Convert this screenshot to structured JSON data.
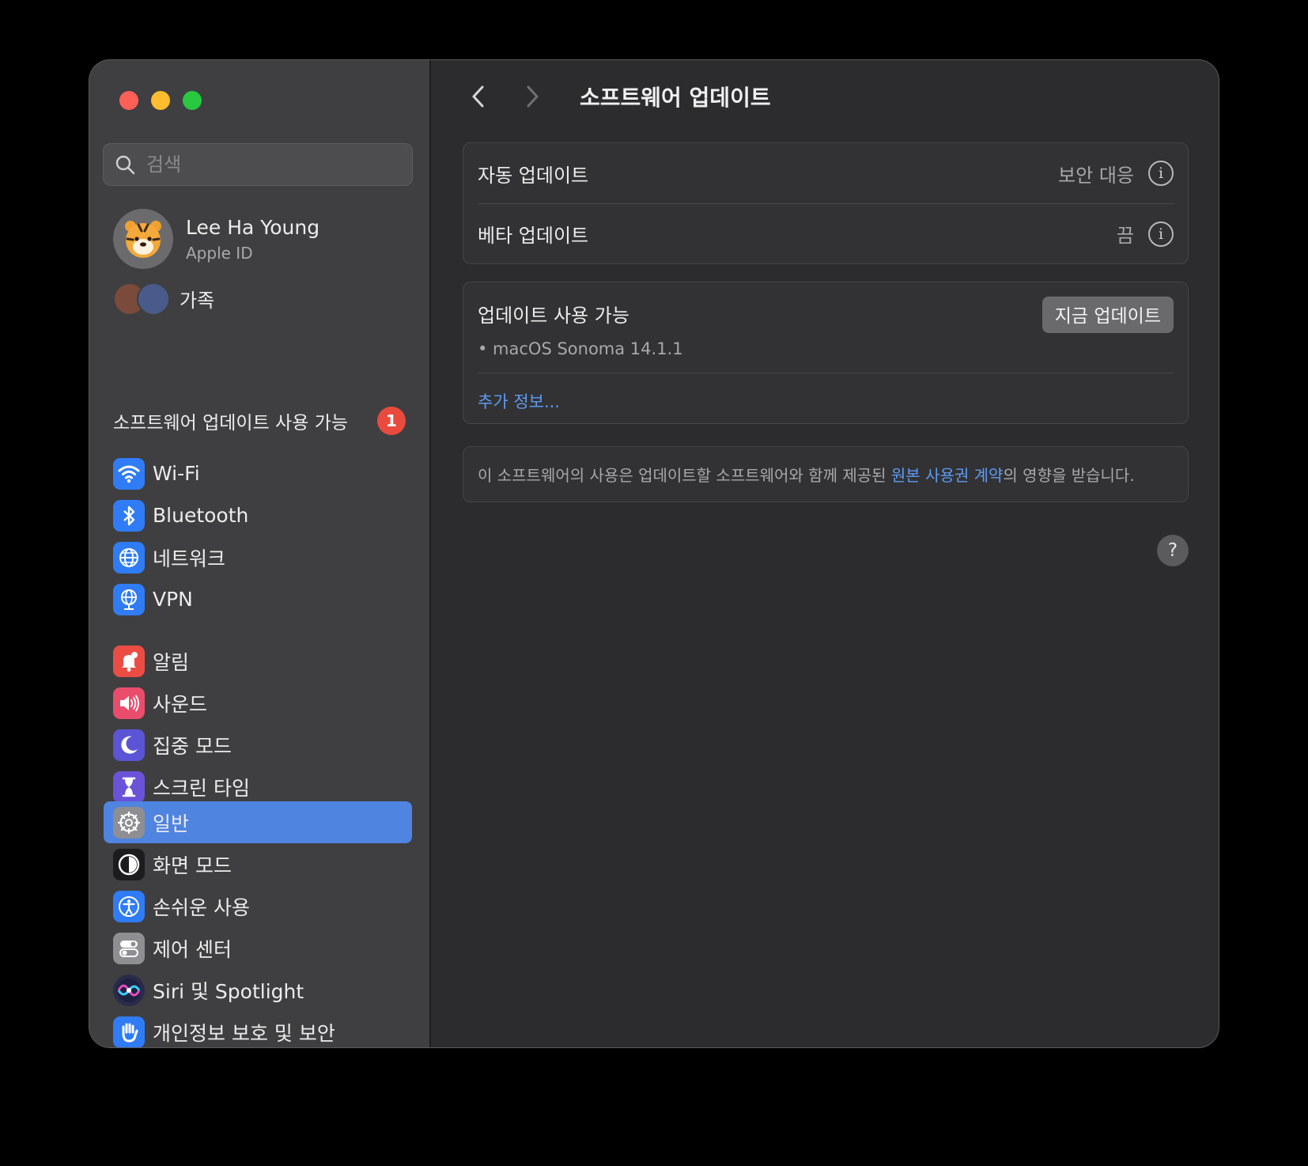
{
  "sidebar": {
    "search_placeholder": "검색",
    "account": {
      "name": "Lee Ha Young",
      "subtitle": "Apple ID"
    },
    "family_label": "가족",
    "software_update": {
      "label": "소프트웨어 업데이트 사용 가능",
      "badge": "1"
    },
    "groups": [
      [
        {
          "label": "Wi-Fi",
          "icon": "wifi-icon",
          "color": "#2f7cf6"
        },
        {
          "label": "Bluetooth",
          "icon": "bluetooth-icon",
          "color": "#2f7cf6"
        },
        {
          "label": "네트워크",
          "icon": "globe-icon",
          "color": "#2f7cf6"
        },
        {
          "label": "VPN",
          "icon": "vpn-globe-icon",
          "color": "#2f7cf6"
        }
      ],
      [
        {
          "label": "알림",
          "icon": "bell-icon",
          "color": "#eb4d45"
        },
        {
          "label": "사운드",
          "icon": "speaker-icon",
          "color": "#ea4d6b"
        },
        {
          "label": "집중 모드",
          "icon": "moon-icon",
          "color": "#5b55d6"
        },
        {
          "label": "스크린 타임",
          "icon": "hourglass-icon",
          "color": "#6c52d9"
        }
      ],
      [
        {
          "label": "일반",
          "icon": "gear-icon",
          "color": "#8e8e93",
          "selected": true
        },
        {
          "label": "화면 모드",
          "icon": "appearance-icon",
          "color": "#1c1c1e"
        },
        {
          "label": "손쉬운 사용",
          "icon": "accessibility-icon",
          "color": "#2f7cf6"
        },
        {
          "label": "제어 센터",
          "icon": "toggles-icon",
          "color": "#8e8e93"
        },
        {
          "label": "Siri 및 Spotlight",
          "icon": "siri-icon",
          "color": "#2a2a4a"
        },
        {
          "label": "개인정보 보호 및 보안",
          "icon": "hand-icon",
          "color": "#2f7cf6"
        }
      ]
    ]
  },
  "main": {
    "title": "소프트웨어 업데이트",
    "settings": [
      {
        "label": "자동 업데이트",
        "value": "보안 대응"
      },
      {
        "label": "베타 업데이트",
        "value": "끔"
      }
    ],
    "available": {
      "title": "업데이트 사용 가능",
      "button": "지금 업데이트",
      "version": "• macOS Sonoma 14.1.1",
      "more": "추가 정보..."
    },
    "license": {
      "before": "이 소프트웨어의 사용은 업데이트할 소프트웨어와 함께 제공된 ",
      "link": "원본 사용권 계약",
      "after": "의 영향을 받습니다."
    },
    "help": "?"
  }
}
